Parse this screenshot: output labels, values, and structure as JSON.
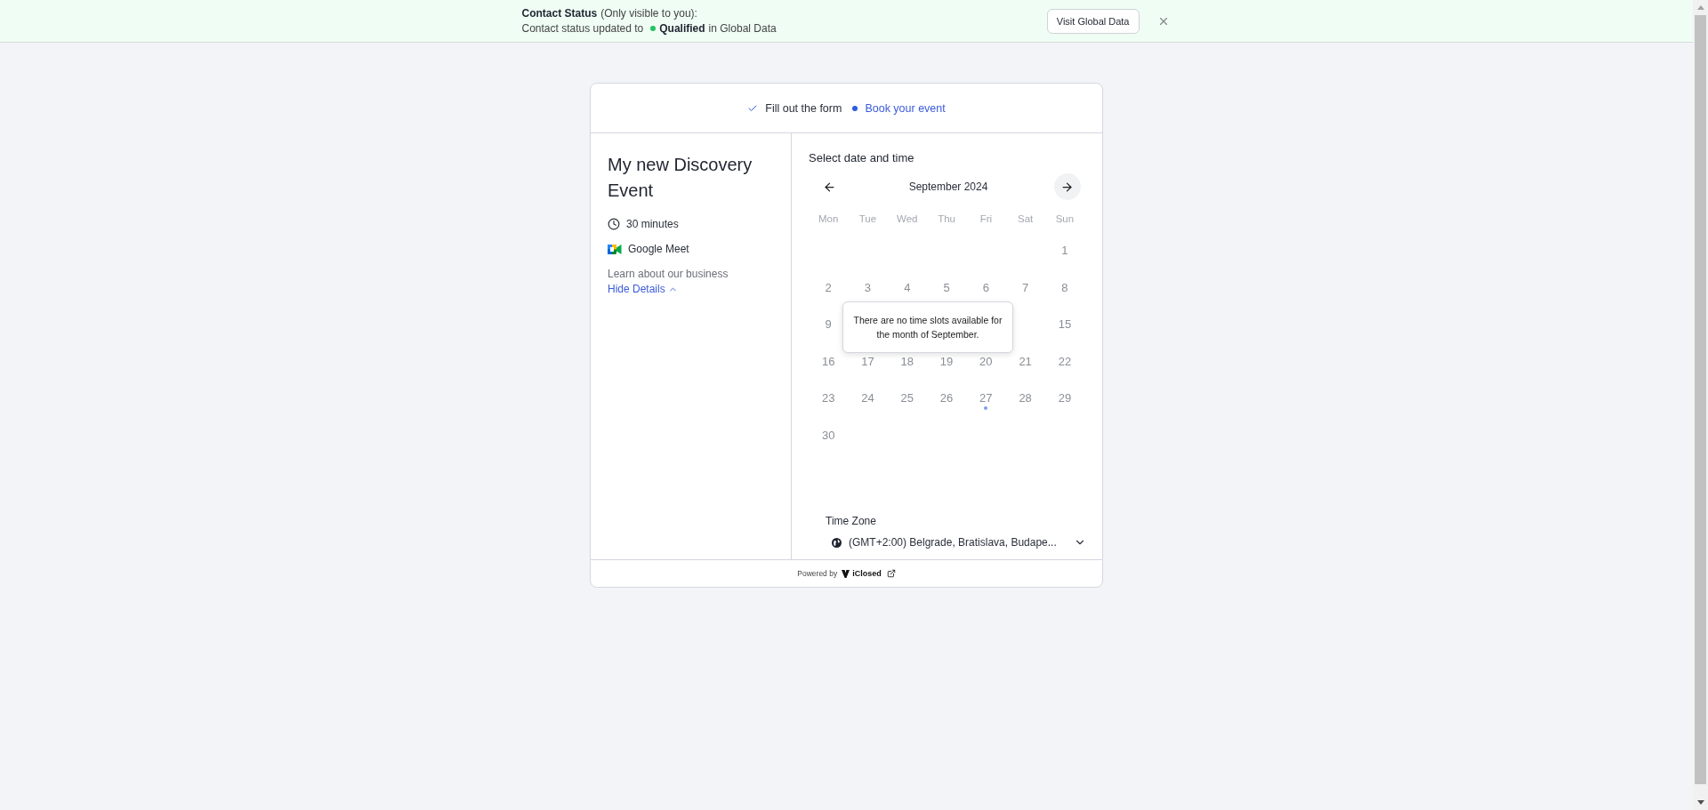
{
  "banner": {
    "title": "Contact Status",
    "note": "(Only visible to you):",
    "message_start": "Contact status updated to",
    "status": "Qualified",
    "message_end": "in Global Data",
    "button": "Visit Global Data"
  },
  "steps": [
    {
      "label": "Fill out the form",
      "completed": true
    },
    {
      "label": "Book your event",
      "completed": false
    }
  ],
  "event": {
    "title": "My new Discovery Event",
    "duration": "30 minutes",
    "location": "Google Meet",
    "description": "Learn about our business",
    "toggle": "Hide Details",
    "expanded": true
  },
  "calendar": {
    "heading": "Select date and time",
    "month": "September 2024",
    "weekdays": [
      "Mon",
      "Tue",
      "Wed",
      "Thu",
      "Fri",
      "Sat",
      "Sun"
    ],
    "weeks": [
      [
        {
          "kind": "blank"
        },
        {
          "kind": "blank"
        },
        {
          "kind": "blank"
        },
        {
          "kind": "blank"
        },
        {
          "kind": "blank"
        },
        {
          "kind": "blank"
        },
        {
          "kind": "day",
          "label": "1",
          "marked": false
        }
      ],
      [
        {
          "kind": "day",
          "label": "2",
          "marked": false
        },
        {
          "kind": "day",
          "label": "3",
          "marked": false
        },
        {
          "kind": "day",
          "label": "4",
          "marked": false
        },
        {
          "kind": "day",
          "label": "5",
          "marked": false
        },
        {
          "kind": "day",
          "label": "6",
          "marked": false
        },
        {
          "kind": "day",
          "label": "7",
          "marked": false
        },
        {
          "kind": "day",
          "label": "8",
          "marked": false
        }
      ],
      [
        {
          "kind": "day",
          "label": "9",
          "marked": false
        },
        {
          "kind": "covered"
        },
        {
          "kind": "covered"
        },
        {
          "kind": "covered"
        },
        {
          "kind": "covered"
        },
        {
          "kind": "covered"
        },
        {
          "kind": "day",
          "label": "15",
          "marked": false
        }
      ],
      [
        {
          "kind": "day",
          "label": "16",
          "marked": false
        },
        {
          "kind": "day",
          "label": "17",
          "marked": false
        },
        {
          "kind": "day",
          "label": "18",
          "marked": false
        },
        {
          "kind": "day",
          "label": "19",
          "marked": false
        },
        {
          "kind": "day",
          "label": "20",
          "marked": false
        },
        {
          "kind": "day",
          "label": "21",
          "marked": false
        },
        {
          "kind": "day",
          "label": "22",
          "marked": false
        }
      ],
      [
        {
          "kind": "day",
          "label": "23",
          "marked": false
        },
        {
          "kind": "day",
          "label": "24",
          "marked": false
        },
        {
          "kind": "day",
          "label": "25",
          "marked": false
        },
        {
          "kind": "day",
          "label": "26",
          "marked": false
        },
        {
          "kind": "day",
          "label": "27",
          "marked": true
        },
        {
          "kind": "day",
          "label": "28",
          "marked": false
        },
        {
          "kind": "day",
          "label": "29",
          "marked": false
        }
      ],
      [
        {
          "kind": "day",
          "label": "30",
          "marked": false
        }
      ]
    ],
    "notice": "There are no time slots available for the month of September."
  },
  "timezone": {
    "label": "Time Zone",
    "value": "(GMT+2:00) Belgrade, Bratislava, Budape..."
  },
  "footer": {
    "powered_by": "Powered by",
    "brand": "iClosed"
  }
}
